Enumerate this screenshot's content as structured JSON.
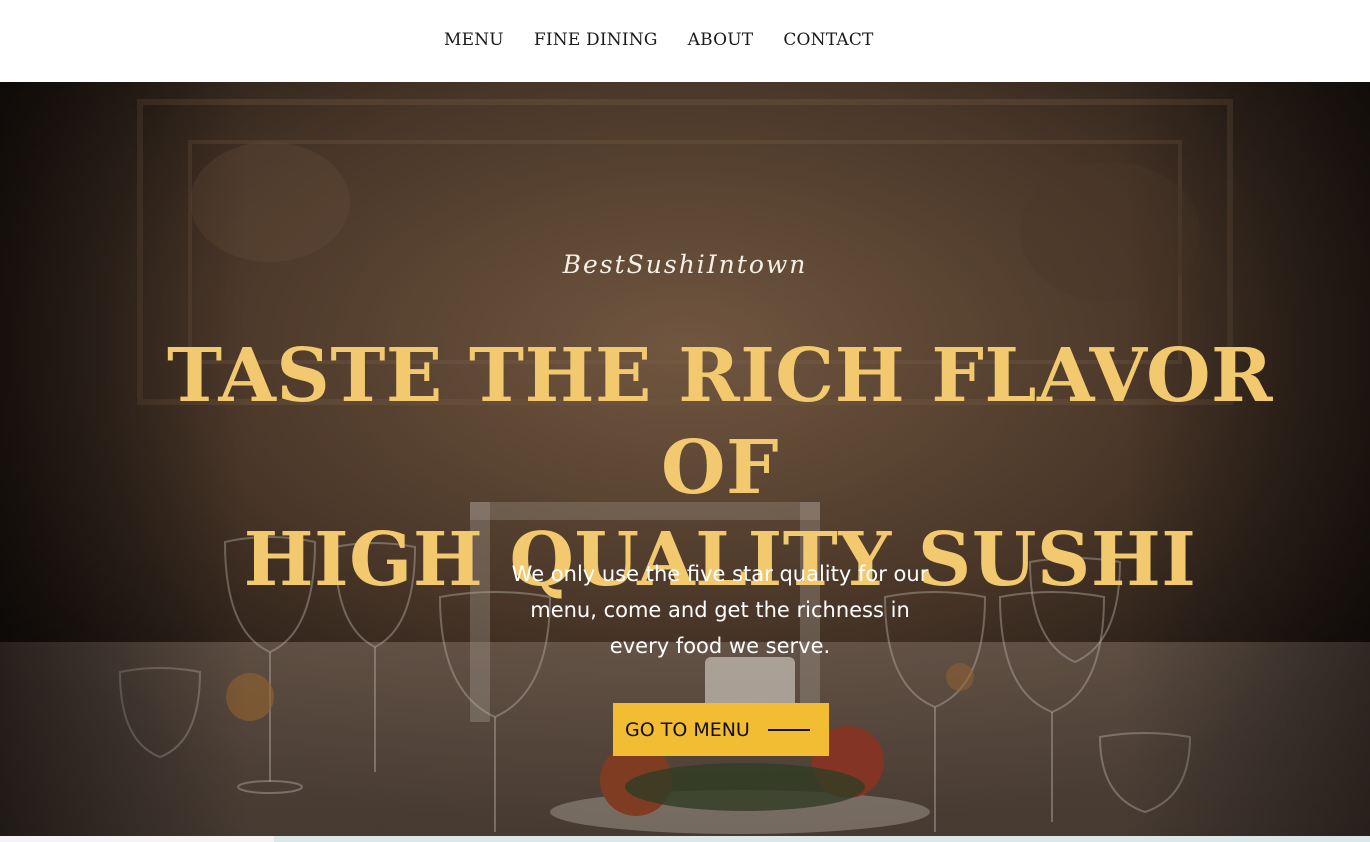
{
  "nav": {
    "items": [
      {
        "label": "MENU"
      },
      {
        "label": "FINE DINING"
      },
      {
        "label": "ABOUT"
      },
      {
        "label": "CONTACT"
      }
    ]
  },
  "hero": {
    "tagline": "BestSushiIntown",
    "headline_line1": "Taste the rich flavor of",
    "headline_line2": "high quality sushi",
    "subtext": "We only use the five star quality for our menu, come and get the richness in every food we serve.",
    "cta_label": "GO TO MENU",
    "icon": "arrow-line-icon",
    "colors": {
      "headline": "#f2c96f",
      "cta_background": "#f2bc33"
    }
  }
}
